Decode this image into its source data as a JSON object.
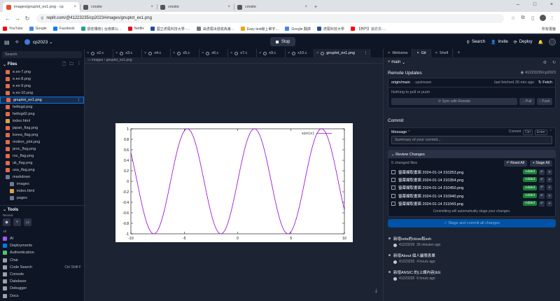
{
  "browser": {
    "tabs": [
      {
        "label": "images/gnuplot_ex1.png - cp",
        "active": true,
        "color": "#e34f26"
      },
      {
        "label": "cmsite",
        "active": false,
        "color": "#555555"
      },
      {
        "label": "cmsite",
        "active": false,
        "color": "#555555"
      },
      {
        "label": "cmsite",
        "active": false,
        "color": "#555555"
      }
    ],
    "url": "replit.com/@41223235/cp2023#images/gnuplot_ex1.png",
    "bookmarks": [
      {
        "label": "YouTube",
        "color": "#ff0000"
      },
      {
        "label": "Google",
        "color": "#4285f4"
      },
      {
        "label": "Facebook",
        "color": "#1877f2"
      },
      {
        "label": "振宏購物 | 台南菜公…",
        "color": "#2a9d8f"
      },
      {
        "label": "Netflix",
        "color": "#e50914"
      },
      {
        "label": "國立虎尾科技大學 -…",
        "color": "#1f4e9c"
      },
      {
        "label": "由虎尾出發成為第…",
        "color": "#777777"
      },
      {
        "label": "Easy test線上單字…",
        "color": "#f4a300"
      },
      {
        "label": "Google 翻譯",
        "color": "#4285f4"
      },
      {
        "label": "虎尾科技大學",
        "color": "#1f4e9c"
      },
      {
        "label": "【熱門】追亦文-…",
        "color": "#ff0000"
      }
    ],
    "bookmarks_right": "所有書籤"
  },
  "header": {
    "repl_name": "cp2023",
    "stop_label": "Stop",
    "search_label": "Search",
    "invite_label": "Invite",
    "deploy_label": "Deploy"
  },
  "sidebar": {
    "search_placeholder": "Search",
    "files_title": "Files",
    "files": [
      {
        "name": "e.ex-7.png",
        "type": "png",
        "indent": false
      },
      {
        "name": "e.ex-8.png",
        "type": "png",
        "indent": false
      },
      {
        "name": "e.ex-9.png",
        "type": "png",
        "indent": false
      },
      {
        "name": "e.ex-10.png",
        "type": "png",
        "indent": false
      },
      {
        "name": "gnuplot_ex1.png",
        "type": "png",
        "indent": false,
        "selected": true
      },
      {
        "name": "hellogd.png",
        "type": "png",
        "indent": false
      },
      {
        "name": "hellogd2.png",
        "type": "png",
        "indent": false
      },
      {
        "name": "index.html",
        "type": "html",
        "indent": false
      },
      {
        "name": "japan_flag.png",
        "type": "png",
        "indent": false
      },
      {
        "name": "korea_flag.png",
        "type": "png",
        "indent": false
      },
      {
        "name": "motion_plot.png",
        "type": "png",
        "indent": false
      },
      {
        "name": "proc_flag.png",
        "type": "png",
        "indent": false
      },
      {
        "name": "roc_flag.png",
        "type": "png",
        "indent": false
      },
      {
        "name": "uk_flag.png",
        "type": "png",
        "indent": false
      },
      {
        "name": "usa_flag.png",
        "type": "png",
        "indent": false
      },
      {
        "name": "markdown",
        "type": "folder",
        "indent": false
      },
      {
        "name": "images",
        "type": "folder",
        "indent": true
      },
      {
        "name": "index.html",
        "type": "html",
        "indent": true
      },
      {
        "name": "pages",
        "type": "folder",
        "indent": true
      }
    ],
    "tools_title": "Tools",
    "recent_label": "Recent",
    "all_label": "All",
    "tools": [
      {
        "name": "AI",
        "color": "#a259ff",
        "shortcut": ""
      },
      {
        "name": "Deployments",
        "color": "#0079f2",
        "shortcut": ""
      },
      {
        "name": "Authentication",
        "color": "#56c26a",
        "shortcut": ""
      },
      {
        "name": "Chat",
        "color": "#9da2a6",
        "shortcut": ""
      },
      {
        "name": "Code Search",
        "color": "#9da2a6",
        "shortcut": "Ctrl Shift F"
      },
      {
        "name": "Console",
        "color": "#9da2a6",
        "shortcut": ""
      },
      {
        "name": "Database",
        "color": "#9da2a6",
        "shortcut": ""
      },
      {
        "name": "Debugger",
        "color": "#9da2a6",
        "shortcut": ""
      },
      {
        "name": "Docs",
        "color": "#9da2a6",
        "shortcut": ""
      }
    ]
  },
  "editor": {
    "tabs": [
      "x2.c",
      "x3.c",
      "x4.c",
      "x5.c",
      "x6.c",
      "x7.c",
      "x9.c",
      "x10.c"
    ],
    "active_tab": "gnuplot_ex1.png",
    "breadcrumb": [
      "images",
      "gnuplot_ex1.png"
    ]
  },
  "chart_data": {
    "type": "line",
    "legend": "sin(x)",
    "function": "sin(x)",
    "xlim": [
      -10,
      10
    ],
    "ylim": [
      -1,
      1
    ],
    "x_ticks": [
      "-10",
      "-5",
      "0",
      "5",
      "10"
    ],
    "y_ticks": [
      "1",
      "0.8",
      "0.6",
      "0.4",
      "0.2",
      "0",
      "-0.2",
      "-0.4",
      "-0.6",
      "-0.8",
      "-1"
    ],
    "line_color": "#9400d3"
  },
  "right_panel": {
    "tabs": [
      "Webview",
      "Git",
      "Shell"
    ],
    "active_tab": "Git",
    "branch": "main",
    "remote_title": "Remote Updates",
    "remote_ref": "41223235/cp2023",
    "origin": "origin/main",
    "upstream": "· upstream",
    "last_fetched": "last fetched 26 min ago",
    "fetch_label": "Fetch",
    "nothing_label": "Nothing to pull or push",
    "sync_label": "Sync with Remote",
    "pull_label": "Pull",
    "push_label": "Push",
    "commit_title": "Commit",
    "message_label": "Message",
    "commit_label": "Commit",
    "ctrl_label": "Ctrl",
    "enter_label": "Enter",
    "message_placeholder": "Summary of your commit...",
    "review_title": "Review Changes",
    "changed_count": "5 changed files",
    "reset_all": "Reset All",
    "stage_all": "Stage All",
    "changes": [
      {
        "file": "螢幕擷取畫面 2024-01-14 210253.png",
        "status": "Added"
      },
      {
        "file": "螢幕擷取畫面 2024-01-14 210354.png",
        "status": "Added"
      },
      {
        "file": "螢幕擷取畫面 2024-01-14 210450.png",
        "status": "Added"
      },
      {
        "file": "螢幕擷取畫面 2024-01-14 210940.png",
        "status": "Added"
      },
      {
        "file": "螢幕擷取畫面 2024-01-14 211043.png",
        "status": "Added"
      }
    ],
    "auto_stage_note": "Committing will automatically stage your changes.",
    "stage_commit_label": "Stage and commit all changes",
    "history": [
      {
        "title": "新增note的close和ssh",
        "author": "41223235",
        "time": "26 minutes ago"
      },
      {
        "title": "新增About 個人屬限表單",
        "author": "41223235",
        "time": "4 hours ago"
      },
      {
        "title": "新增ANSIC 的(上課內容)EE",
        "author": "41223235",
        "time": "6 hours ago"
      }
    ]
  }
}
